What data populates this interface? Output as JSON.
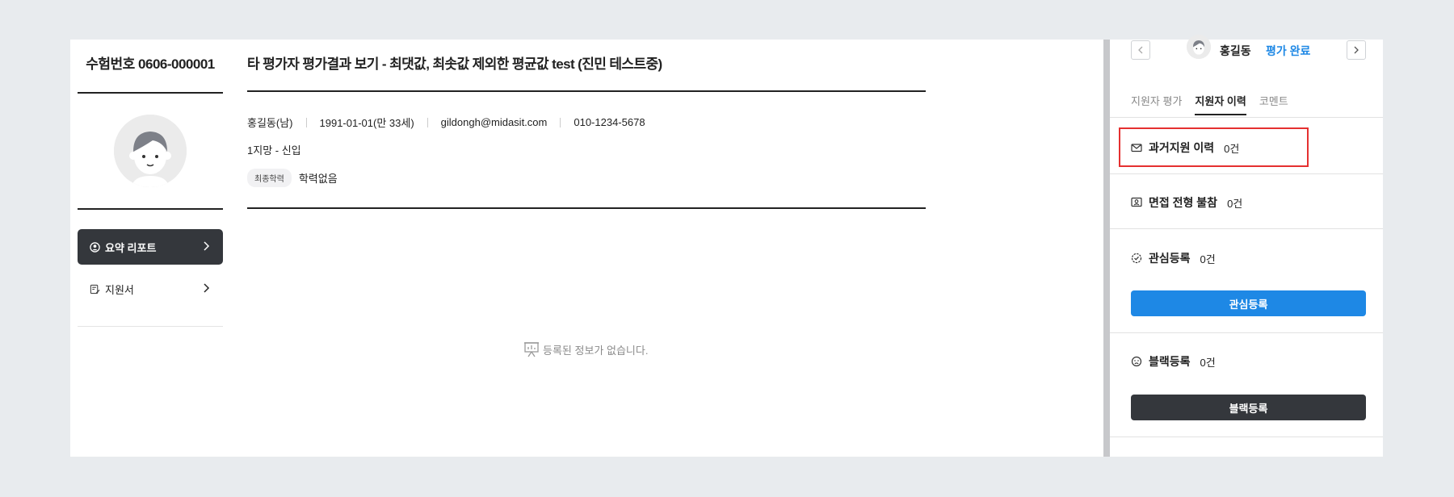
{
  "left": {
    "exam_no": "수험번호 0606-000001",
    "menu": [
      {
        "label": "요약 리포트",
        "icon": "user-circle-icon",
        "active": true
      },
      {
        "label": "지원서",
        "icon": "document-pen-icon",
        "active": false
      }
    ]
  },
  "main": {
    "title": "타 평가자 평가결과 보기 - 최댓값, 최솟값 제외한 평균값 test (진민 테스트중)",
    "profile": {
      "name_gender": "홍길동(남)",
      "birth": "1991-01-01(만 33세)",
      "email": "gildongh@midasit.com",
      "phone": "010-1234-5678",
      "preference": "1지망 - 신입",
      "edu_badge": "최종학력",
      "edu_value": "학력없음"
    },
    "empty_message": "등록된 정보가 없습니다."
  },
  "right": {
    "candidate_name": "홍길동",
    "candidate_status": "평가 완료",
    "prev_icon": "chevron-left-icon",
    "next_icon": "chevron-right-icon",
    "tabs": [
      {
        "label": "지원자 평가",
        "active": false
      },
      {
        "label": "지원자 이력",
        "active": true
      },
      {
        "label": "코멘트",
        "active": false
      }
    ],
    "sections": {
      "past": {
        "title": "과거지원 이력",
        "count": "0건",
        "icon": "envelope-icon"
      },
      "interview": {
        "title": "면접 전형 불참",
        "count": "0건",
        "icon": "person-card-icon"
      },
      "interest": {
        "title": "관심등록",
        "count": "0건",
        "icon": "check-circle-icon",
        "button": "관심등록"
      },
      "black": {
        "title": "블랙등록",
        "count": "0건",
        "icon": "sad-face-icon",
        "button": "블랙등록"
      }
    }
  },
  "colors": {
    "accent_blue": "#1e88e5",
    "dark": "#34373c",
    "highlight": "#e53030"
  }
}
